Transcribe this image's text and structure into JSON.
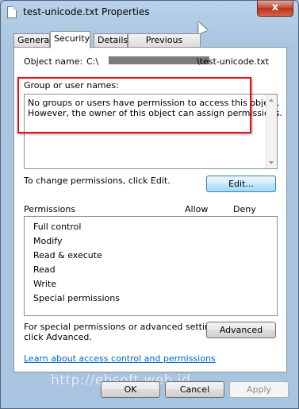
{
  "window": {
    "title": "test-unicode.txt Properties",
    "close_glyph": "x"
  },
  "tabs": [
    {
      "label": "General",
      "active": false
    },
    {
      "label": "Security",
      "active": true
    },
    {
      "label": "Details",
      "active": false
    },
    {
      "label": "Previous Versions",
      "active": false
    }
  ],
  "security": {
    "object_name_label": "Object name:",
    "object_name_prefix": "C:\\",
    "object_name_suffix": "\\test-unicode.txt",
    "group_label": "Group or user names:",
    "group_message_line1": "No groups or users have permission to access this object.",
    "group_message_line2": "However, the owner of this object can assign permissions.",
    "change_text": "To change permissions, click Edit.",
    "edit_button": "Edit...",
    "permissions_header": "Permissions",
    "allow_header": "Allow",
    "deny_header": "Deny",
    "permissions": [
      "Full control",
      "Modify",
      "Read & execute",
      "Read",
      "Write",
      "Special permissions"
    ],
    "special_text_line1": "For special permissions or advanced settings,",
    "special_text_line2": "click Advanced.",
    "advanced_button": "Advanced",
    "learn_link": "Learn about access control and permissions"
  },
  "footer": {
    "ok_button": "OK",
    "cancel_button": "Cancel",
    "apply_button": "Apply",
    "watermark": "http://ebsoft.web.id"
  },
  "colors": {
    "highlight_border": "#e0101b",
    "link": "#0066cc",
    "frame": "#a9c4e0"
  }
}
